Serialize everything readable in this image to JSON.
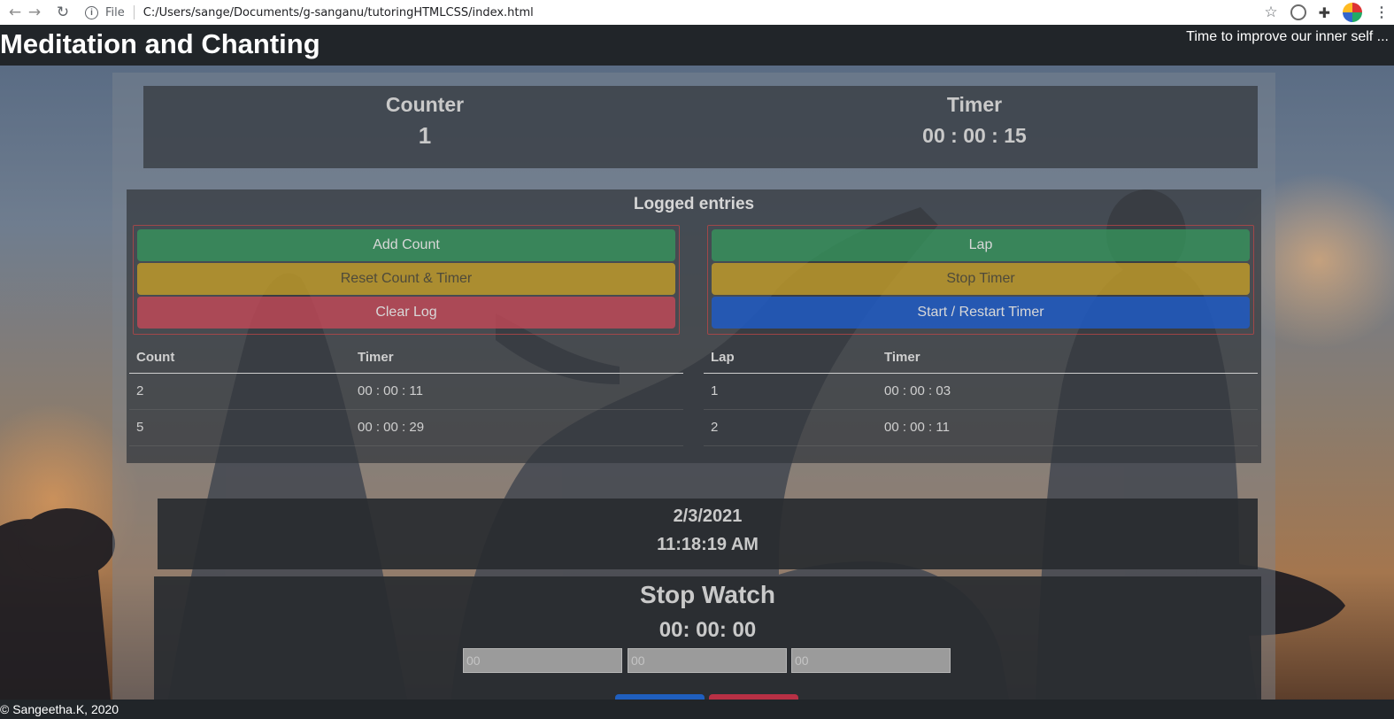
{
  "browser": {
    "file_label": "File",
    "url": "C:/Users/sange/Documents/g-sanganu/tutoringHTMLCSS/index.html"
  },
  "header": {
    "title": "Meditation and Chanting",
    "tagline": "Time to improve our inner self ..."
  },
  "stats": {
    "counter_label": "Counter",
    "counter_value": "1",
    "timer_label": "Timer",
    "timer_value": "00 : 00 : 15"
  },
  "log": {
    "title": "Logged entries",
    "count_buttons": [
      "Add Count",
      "Reset Count & Timer",
      "Clear Log"
    ],
    "timer_buttons": [
      "Lap",
      "Stop Timer",
      "Start / Restart Timer"
    ],
    "count_table": {
      "headers": [
        "Count",
        "Timer"
      ],
      "rows": [
        [
          "2",
          "00 : 00 : 11"
        ],
        [
          "5",
          "00 : 00 : 29"
        ]
      ]
    },
    "lap_table": {
      "headers": [
        "Lap",
        "Timer"
      ],
      "rows": [
        [
          "1",
          "00 : 00 : 03"
        ],
        [
          "2",
          "00 : 00 : 11"
        ]
      ]
    }
  },
  "datetime": {
    "date": "2/3/2021",
    "time": "11:18:19 AM"
  },
  "stopwatch": {
    "title": "Stop Watch",
    "display": "00: 00: 00",
    "hours_placeholder": "00",
    "minutes_placeholder": "00",
    "seconds_placeholder": "00"
  },
  "footer": {
    "text": "© Sangeetha.K, 2020"
  },
  "colors": {
    "header_bg": "#212529",
    "green": "#36965c",
    "yellow": "#c49e28",
    "red": "#c44858",
    "blue": "#1e5cc8"
  }
}
